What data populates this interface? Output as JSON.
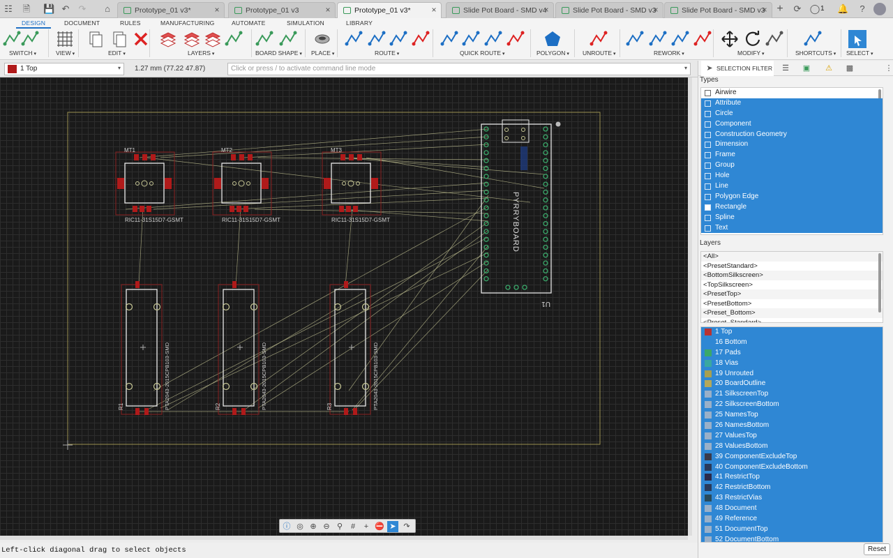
{
  "tabbar": {
    "tabs": [
      {
        "label": "Prototype_01 v3*",
        "active": false
      },
      {
        "label": "Prototype_01 v3",
        "active": false
      },
      {
        "label": "Prototype_01 v3*",
        "active": true
      },
      {
        "label": "Slide Pot Board - SMD v4",
        "active": false
      },
      {
        "label": "Slide Pot Board - SMD v3",
        "active": false
      },
      {
        "label": "Slide Pot Board - SMD v3",
        "active": false
      }
    ],
    "notification_count": "1"
  },
  "ribbon": {
    "tabs": [
      "DESIGN",
      "DOCUMENT",
      "RULES",
      "MANUFACTURING",
      "AUTOMATE",
      "SIMULATION",
      "LIBRARY"
    ],
    "active_tab": "DESIGN",
    "groups": [
      "SWITCH",
      "VIEW",
      "EDIT",
      "LAYERS",
      "BOARD SHAPE",
      "PLACE",
      "ROUTE",
      "QUICK ROUTE",
      "POLYGON",
      "UNROUTE",
      "REWORK",
      "MODIFY",
      "SHORTCUTS",
      "SELECT"
    ]
  },
  "cmdbar": {
    "layer": "1 Top",
    "layer_color": "#b01a1a",
    "coordinates": "1.27 mm (77.22 47.87)",
    "command_placeholder": "Click or press / to activate command line mode"
  },
  "pcb": {
    "switch_refs": [
      "MT1",
      "MT2",
      "MT3"
    ],
    "switch_value": "RIC11-31S15D7-GSMT",
    "pot_refs": [
      "R1",
      "R2",
      "R3"
    ],
    "pot_value": "PTA2043-2015CPB103-SMD",
    "module_label": "PYRRYBOARD",
    "module_ref": "U1"
  },
  "status": {
    "text": "Left-click diagonal drag to select objects"
  },
  "panel": {
    "selection_filter_label": "SELECTION FILTER",
    "types_title": "Types",
    "types": [
      {
        "label": "Airwire",
        "selected": false
      },
      {
        "label": "Attribute",
        "selected": true
      },
      {
        "label": "Circle",
        "selected": true
      },
      {
        "label": "Component",
        "selected": true
      },
      {
        "label": "Construction Geometry",
        "selected": true
      },
      {
        "label": "Dimension",
        "selected": true
      },
      {
        "label": "Frame",
        "selected": true
      },
      {
        "label": "Group",
        "selected": true
      },
      {
        "label": "Hole",
        "selected": true
      },
      {
        "label": "Line",
        "selected": true
      },
      {
        "label": "Polygon Edge",
        "selected": true
      },
      {
        "label": "Rectangle",
        "selected": true
      },
      {
        "label": "Spline",
        "selected": true
      },
      {
        "label": "Text",
        "selected": true
      }
    ],
    "layers_title": "Layers",
    "presets": [
      "<All>",
      "<PresetStandard>",
      "<BottomSilkscreen>",
      "<TopSilkscreen>",
      "<PresetTop>",
      "<PresetBottom>",
      "<Preset_Bottom>",
      "<Preset_Standard>"
    ],
    "layers": [
      {
        "label": "1 Top",
        "color": "#b83232"
      },
      {
        "label": "16 Bottom",
        "color": "#2f87d4"
      },
      {
        "label": "17 Pads",
        "color": "#3aa86a"
      },
      {
        "label": "18 Vias",
        "color": "#3aa8a0"
      },
      {
        "label": "19 Unrouted",
        "color": "#a8a050"
      },
      {
        "label": "20 BoardOutline",
        "color": "#b4a85a"
      },
      {
        "label": "21 SilkscreenTop",
        "color": "#9ab0c8"
      },
      {
        "label": "22 SilkscreenBottom",
        "color": "#9ab0c8"
      },
      {
        "label": "25 NamesTop",
        "color": "#9ab0c8"
      },
      {
        "label": "26 NamesBottom",
        "color": "#9ab0c8"
      },
      {
        "label": "27 ValuesTop",
        "color": "#9ab0c8"
      },
      {
        "label": "28 ValuesBottom",
        "color": "#9ab0c8"
      },
      {
        "label": "39 ComponentExcludeTop",
        "color": "#3a3a4a"
      },
      {
        "label": "40 ComponentExcludeBottom",
        "color": "#2a3a5a"
      },
      {
        "label": "41 RestrictTop",
        "color": "#2a2a4a"
      },
      {
        "label": "42 RestrictBottom",
        "color": "#2a3a5a"
      },
      {
        "label": "43 RestrictVias",
        "color": "#2a4a5a"
      },
      {
        "label": "48 Document",
        "color": "#9ab0c8"
      },
      {
        "label": "49 Reference",
        "color": "#9ab0c8"
      },
      {
        "label": "51 DocumentTop",
        "color": "#9ab0c8"
      },
      {
        "label": "52 DocumentBottom",
        "color": "#9ab0c8"
      }
    ],
    "reset_label": "Reset"
  }
}
